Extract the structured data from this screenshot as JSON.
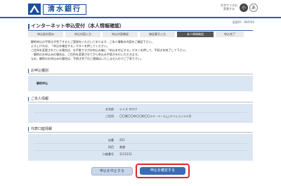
{
  "header": {
    "bank_name": "清水銀行",
    "text_size_label": "文字サイズの変更する",
    "size_small": "小",
    "size_large": "あ"
  },
  "screen_id": "画面ID：INH500",
  "page_title": "インターネット申込受付（本人情報確認）",
  "steps": [
    {
      "label": "申込前お読み"
    },
    {
      "label": "申込内容入力"
    },
    {
      "label": "申込内容確認"
    },
    {
      "label": "暗証番号入力"
    },
    {
      "label": "本人情報確認"
    },
    {
      "label": "申込完了"
    }
  ],
  "intro": [
    "解約申込の手続きが完了するとご登録をいただいております、ご本人情報の内容をご確認下さい。",
    "よろしければ、「申込を確定する」ボタンを押してください。",
    "ご住所を変更されている場合は、お手数ですがお申込み後に「申込を中止する」ボタンを押して、手続きを終了して下さい。",
    "・解約のお申込みの場合は、ご住所を変更されてから申込み手続きを行いただきます。",
    "なお、解約のお申込みの場合は、手続き完了のご連絡はいたしませんのでご了承下さい。"
  ],
  "application": {
    "section_title": "お申込種別",
    "value": "解約申込"
  },
  "personal": {
    "section_title": "ご本人情報",
    "rows": [
      {
        "label": "お名前",
        "value": "シミズ タロウ"
      },
      {
        "label": "ご住所",
        "value": "〇〇県〇〇市〇〇町〇〇××－×－×△△マンション××号"
      }
    ]
  },
  "account": {
    "section_title": "代表口座情報",
    "rows": [
      {
        "label": "店番",
        "value": "251"
      },
      {
        "label": "科目",
        "value": "普通"
      },
      {
        "label": "口座番号",
        "value": "1111111"
      }
    ]
  },
  "buttons": {
    "cancel": "申込を中止する",
    "confirm": "申込を確定する"
  },
  "colors": {
    "brand_blue": "#2b5ea7",
    "panel_bg": "#dbe6f3",
    "highlight_red": "#e0242f"
  }
}
